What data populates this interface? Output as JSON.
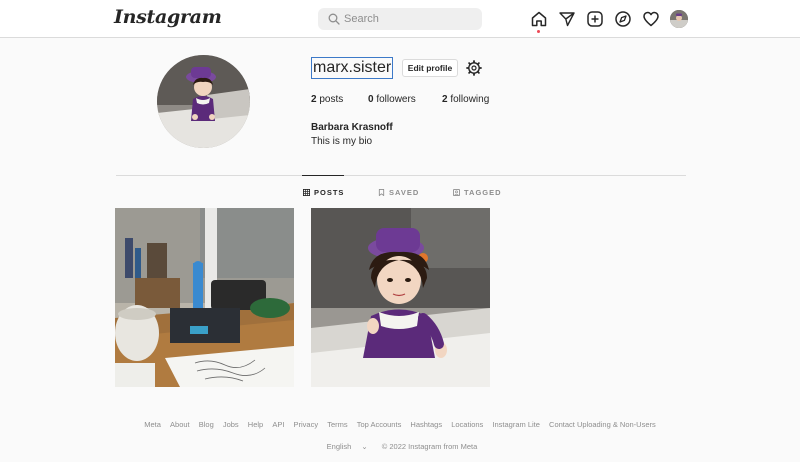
{
  "header": {
    "logo": "Instagram",
    "search_placeholder": "Search",
    "nav_icons": [
      "home-icon",
      "direct-icon",
      "new-post-icon",
      "explore-icon",
      "activity-heart-icon",
      "profile-avatar"
    ]
  },
  "profile": {
    "username": "marx.sister",
    "edit_profile_label": "Edit profile",
    "stats": [
      {
        "count": "2",
        "label": "posts"
      },
      {
        "count": "0",
        "label": "followers"
      },
      {
        "count": "2",
        "label": "following"
      }
    ],
    "full_name": "Barbara Krasnoff",
    "bio": "This is my bio"
  },
  "tabs": [
    {
      "label": "POSTS",
      "active": true,
      "icon": "grid-icon"
    },
    {
      "label": "SAVED",
      "active": false,
      "icon": "bookmark-icon"
    },
    {
      "label": "TAGGED",
      "active": false,
      "icon": "tag-icon"
    }
  ],
  "posts": [
    {
      "description_icon": "desk-photo"
    },
    {
      "description_icon": "doll-photo"
    }
  ],
  "footer": {
    "links": [
      "Meta",
      "About",
      "Blog",
      "Jobs",
      "Help",
      "API",
      "Privacy",
      "Terms",
      "Top Accounts",
      "Hashtags",
      "Locations",
      "Instagram Lite",
      "Contact Uploading & Non-Users"
    ],
    "language": "English",
    "copyright": "© 2022 Instagram from Meta"
  },
  "colors": {
    "accent_focus": "#3c79c8",
    "notification_dot": "#ed4956",
    "text_primary": "#262626",
    "text_secondary": "#8e8e8e",
    "border": "#dbdbdb"
  }
}
